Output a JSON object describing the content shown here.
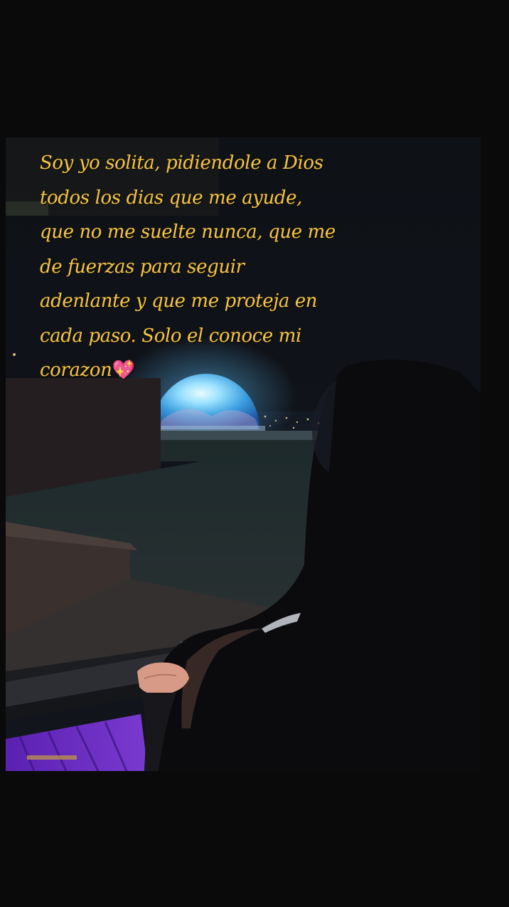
{
  "story": {
    "caption_text": "Soy yo solita, pidiendole a Dios\ntodos los dias que me ayude,\nque no me suelte nunca, que me\nde fuerzas para seguir\nadenlante y que me proteja en\ncada paso. Solo el conoce mi\ncorazon",
    "caption_emoji": "💖",
    "caption_color": "#f0c44a"
  },
  "photo": {
    "subject": "person looking out a window at a glowing dome at night",
    "sphere_color": "#7fd0ff",
    "floor_color": "#6a2cc4"
  }
}
